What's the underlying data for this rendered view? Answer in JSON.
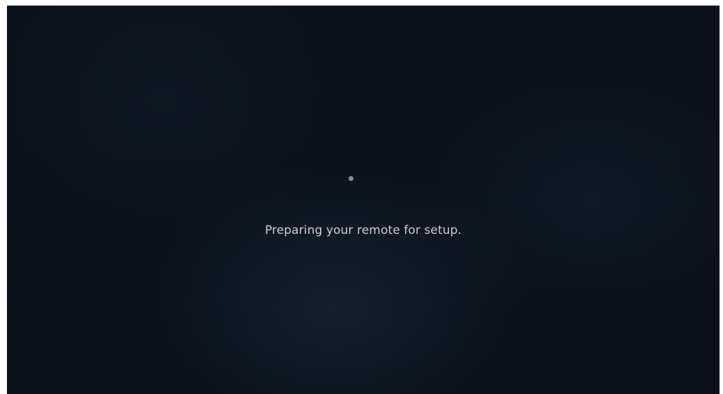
{
  "screen": {
    "status_message": "Preparing your remote for setup.",
    "loading_indicator": "spinner-dot"
  },
  "colors": {
    "background": "#0b121b",
    "text": "#c9cfd6",
    "spinner": "#9aa3ad"
  }
}
